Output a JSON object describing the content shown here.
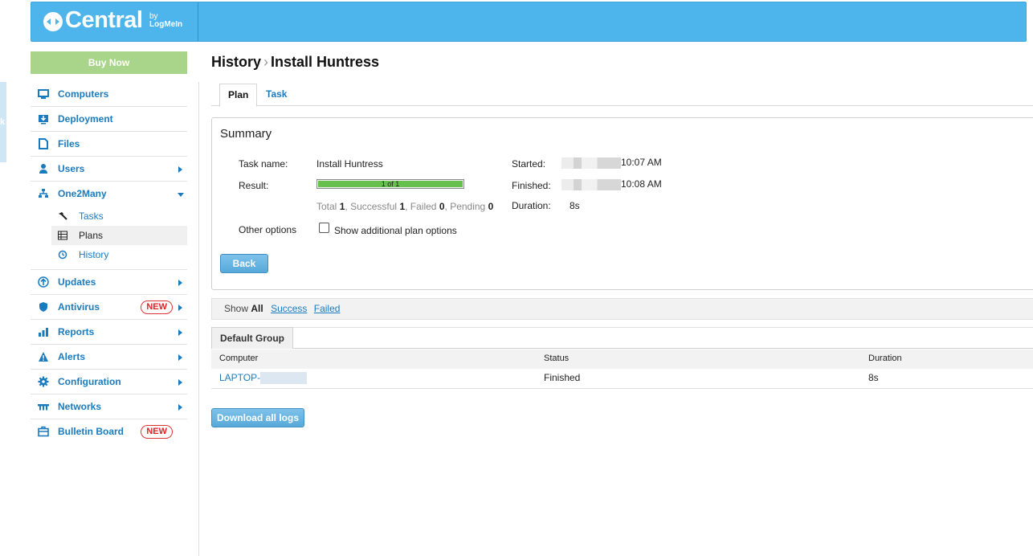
{
  "header": {
    "logo_text": "Central",
    "logo_by": "by",
    "logo_brand": "LogMeIn",
    "left_tab_glyph": "k"
  },
  "sidebar": {
    "buy_now": "Buy Now",
    "items": [
      {
        "label": "Computers",
        "icon": "monitor-icon"
      },
      {
        "label": "Deployment",
        "icon": "deployment-icon"
      },
      {
        "label": "Files",
        "icon": "file-icon"
      },
      {
        "label": "Users",
        "icon": "user-icon"
      },
      {
        "label": "One2Many",
        "icon": "network-tree-icon"
      },
      {
        "label": "Updates",
        "icon": "up-arrow-circle-icon"
      },
      {
        "label": "Antivirus",
        "icon": "shield-icon",
        "badge": "NEW"
      },
      {
        "label": "Reports",
        "icon": "bar-chart-icon"
      },
      {
        "label": "Alerts",
        "icon": "warning-icon"
      },
      {
        "label": "Configuration",
        "icon": "gear-icon"
      },
      {
        "label": "Networks",
        "icon": "network-icon"
      },
      {
        "label": "Bulletin Board",
        "icon": "bulletin-icon",
        "badge": "NEW"
      }
    ],
    "sub_items": [
      {
        "label": "Tasks",
        "icon": "hammer-icon"
      },
      {
        "label": "Plans",
        "icon": "grid-icon"
      },
      {
        "label": "History",
        "icon": "history-icon"
      }
    ]
  },
  "title": {
    "part1": "History",
    "sep": "›",
    "part2": "Install Huntress"
  },
  "tabs": {
    "plan": "Plan",
    "task": "Task"
  },
  "summary": {
    "title": "Summary",
    "task_name_label": "Task name:",
    "task_name_value": "Install Huntress",
    "result_label": "Result:",
    "progress_text": "1 of 1",
    "progress_fraction": 1.0,
    "totals": {
      "total_label": "Total",
      "total": "1",
      "successful_label": "Successful",
      "successful": "1",
      "failed_label": "Failed",
      "failed": "0",
      "pending_label": "Pending",
      "pending": "0"
    },
    "started_label": "Started:",
    "started_time": "10:07 AM",
    "finished_label": "Finished:",
    "finished_time": "10:08 AM",
    "duration_label": "Duration:",
    "duration_value": "8s",
    "other_options_label": "Other options",
    "show_additional_label": "Show additional plan options",
    "back_button": "Back"
  },
  "filter": {
    "show_label": "Show",
    "all": "All",
    "success": "Success",
    "failed": "Failed"
  },
  "group": {
    "tab_label": "Default Group"
  },
  "table": {
    "headers": [
      "Computer",
      "Status",
      "Duration"
    ],
    "rows": [
      {
        "computer": "LAPTOP-",
        "status": "Finished",
        "duration": "8s"
      }
    ]
  },
  "download_button": "Download all logs",
  "colors": {
    "header": "#4db4ec",
    "buy_now": "#a9d58b",
    "link": "#1a7bbf",
    "progress": "#65c04e",
    "badge": "#e02020"
  }
}
